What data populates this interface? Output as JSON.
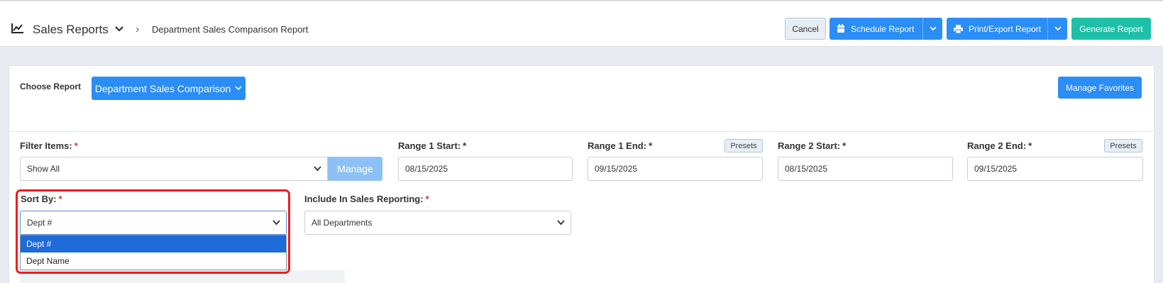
{
  "header": {
    "section_title": "Sales Reports",
    "breadcrumb_separator": "›",
    "current_page": "Department Sales Comparison Report",
    "buttons": {
      "cancel": "Cancel",
      "schedule": "Schedule Report",
      "print_export": "Print/Export Report",
      "generate": "Generate Report"
    }
  },
  "report_chooser": {
    "label": "Choose Report",
    "selected": "Department Sales Comparison",
    "manage_favorites": "Manage Favorites"
  },
  "filters": {
    "filter_items": {
      "label": "Filter Items:",
      "required_mark": "*",
      "value": "Show All",
      "manage_button": "Manage"
    },
    "range1_start": {
      "label": "Range 1 Start:",
      "required_mark": "*",
      "value": "08/15/2025"
    },
    "range1_end": {
      "label": "Range 1 End:",
      "required_mark": "*",
      "value": "09/15/2025",
      "presets": "Presets"
    },
    "range2_start": {
      "label": "Range 2 Start:",
      "required_mark": "*",
      "value": "08/15/2025"
    },
    "range2_end": {
      "label": "Range 2 End:",
      "required_mark": "*",
      "value": "09/15/2025",
      "presets": "Presets"
    },
    "sort_by": {
      "label": "Sort By:",
      "required_mark": "*",
      "value": "Dept #",
      "options": [
        "Dept #",
        "Dept Name"
      ]
    },
    "include_in_sales": {
      "label": "Include In Sales Reporting:",
      "required_mark": "*",
      "value": "All Departments"
    }
  },
  "colors": {
    "primary": "#2b8df6",
    "success": "#1ec0a7",
    "highlight": "#ee1c24",
    "selected_option": "#1d6ad8"
  },
  "icons": {
    "section": "line-chart-icon",
    "schedule": "calendar-icon",
    "print": "printer-icon"
  }
}
